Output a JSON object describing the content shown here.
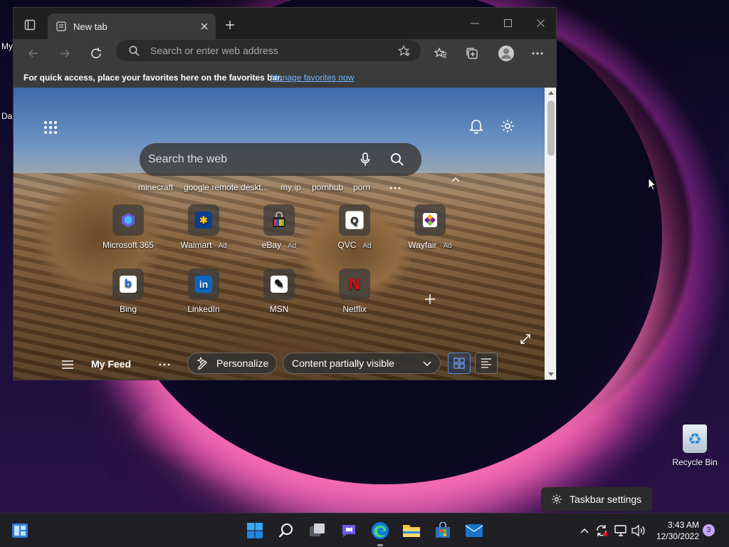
{
  "desktop": {
    "left_labels": [
      "My",
      "Da"
    ],
    "recycle_bin_label": "Recycle Bin",
    "taskbar_settings_label": "Taskbar settings"
  },
  "browser": {
    "tab_title": "New tab",
    "address_placeholder": "Search or enter web address",
    "favorites_message": "For quick access, place your favorites here on the favorites bar.",
    "favorites_link": "Manage favorites now"
  },
  "newtab": {
    "search_placeholder": "Search the web",
    "quick_links": [
      "minecraft",
      "google remote deskt...",
      "my ip",
      "pornhub",
      "porn"
    ],
    "tiles": [
      {
        "label": "Microsoft 365",
        "ad": "",
        "icon": "microsoft-365-icon"
      },
      {
        "label": "Walmart",
        "ad": "· Ad",
        "icon": "walmart-icon"
      },
      {
        "label": "eBay",
        "ad": "· Ad",
        "icon": "ebay-icon"
      },
      {
        "label": "QVC",
        "ad": "· Ad",
        "icon": "qvc-icon"
      },
      {
        "label": "Wayfair",
        "ad": "· Ad",
        "icon": "wayfair-icon"
      },
      {
        "label": "Bing",
        "ad": "",
        "icon": "bing-icon"
      },
      {
        "label": "LinkedIn",
        "ad": "",
        "icon": "linkedin-icon"
      },
      {
        "label": "MSN",
        "ad": "",
        "icon": "msn-icon"
      },
      {
        "label": "Netflix",
        "ad": "",
        "icon": "netflix-icon"
      }
    ],
    "feed": {
      "title": "My Feed",
      "personalize": "Personalize",
      "content_visibility": "Content partially visible"
    }
  },
  "taskbar": {
    "time": "3:43 AM",
    "date": "12/30/2022",
    "notification_count": "3"
  },
  "colors": {
    "accent": "#0078d4",
    "link": "#6fb6ff"
  }
}
